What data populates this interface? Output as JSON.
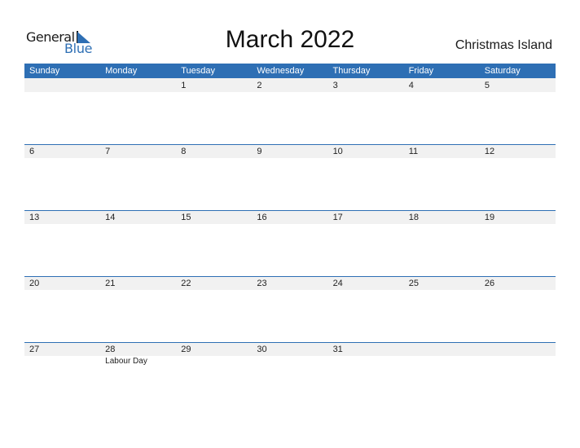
{
  "logo": {
    "line1": "General",
    "line2": "Blue"
  },
  "title": "March 2022",
  "region": "Christmas Island",
  "colors": {
    "accent": "#2e6fb4",
    "strip": "#f1f1f1"
  },
  "weekdays": [
    "Sunday",
    "Monday",
    "Tuesday",
    "Wednesday",
    "Thursday",
    "Friday",
    "Saturday"
  ],
  "weeks": [
    {
      "days": [
        {
          "num": ""
        },
        {
          "num": ""
        },
        {
          "num": "1"
        },
        {
          "num": "2"
        },
        {
          "num": "3"
        },
        {
          "num": "4"
        },
        {
          "num": "5"
        }
      ]
    },
    {
      "days": [
        {
          "num": "6"
        },
        {
          "num": "7"
        },
        {
          "num": "8"
        },
        {
          "num": "9"
        },
        {
          "num": "10"
        },
        {
          "num": "11"
        },
        {
          "num": "12"
        }
      ]
    },
    {
      "days": [
        {
          "num": "13"
        },
        {
          "num": "14"
        },
        {
          "num": "15"
        },
        {
          "num": "16"
        },
        {
          "num": "17"
        },
        {
          "num": "18"
        },
        {
          "num": "19"
        }
      ]
    },
    {
      "days": [
        {
          "num": "20"
        },
        {
          "num": "21"
        },
        {
          "num": "22"
        },
        {
          "num": "23"
        },
        {
          "num": "24"
        },
        {
          "num": "25"
        },
        {
          "num": "26"
        }
      ]
    },
    {
      "days": [
        {
          "num": "27"
        },
        {
          "num": "28",
          "event": "Labour Day"
        },
        {
          "num": "29"
        },
        {
          "num": "30"
        },
        {
          "num": "31"
        },
        {
          "num": ""
        },
        {
          "num": ""
        }
      ]
    }
  ]
}
